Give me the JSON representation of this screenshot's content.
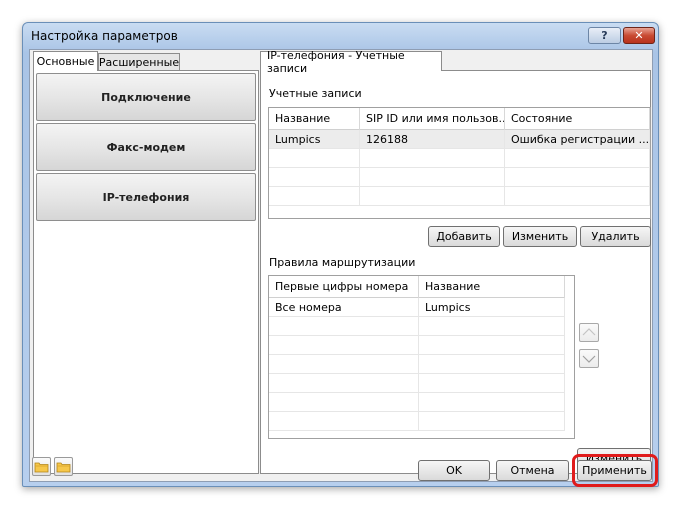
{
  "window": {
    "title": "Настройка параметров",
    "help_label": "?",
    "close_label": "✕"
  },
  "left_tabs": [
    {
      "label": "Основные"
    },
    {
      "label": "Расширенные"
    }
  ],
  "nav_buttons": [
    {
      "label": "Подключение"
    },
    {
      "label": "Факс-модем"
    },
    {
      "label": "IP-телефония"
    }
  ],
  "right_tab": {
    "label": "IP-телефония - Учетные записи"
  },
  "accounts": {
    "label": "Учетные записи",
    "columns": [
      "Название",
      "SIP ID или имя пользов...",
      "Состояние"
    ],
    "rows": [
      {
        "name": "Lumpics",
        "sip_id": "126188",
        "status": "Ошибка регистрации ..."
      }
    ],
    "add_label": "Добавить",
    "edit_label": "Изменить",
    "delete_label": "Удалить"
  },
  "routing": {
    "label": "Правила маршрутизации",
    "columns": [
      "Первые цифры номера",
      "Название"
    ],
    "rows": [
      {
        "digits": "Все номера",
        "name": "Lumpics"
      }
    ],
    "edit_label": "Изменить"
  },
  "footer": {
    "ok_label": "OK",
    "cancel_label": "Отмена",
    "apply_label": "Применить"
  },
  "colors": {
    "highlight": "#e01b1b",
    "titlebar": "#b7cfee",
    "close_button": "#c94b33"
  }
}
